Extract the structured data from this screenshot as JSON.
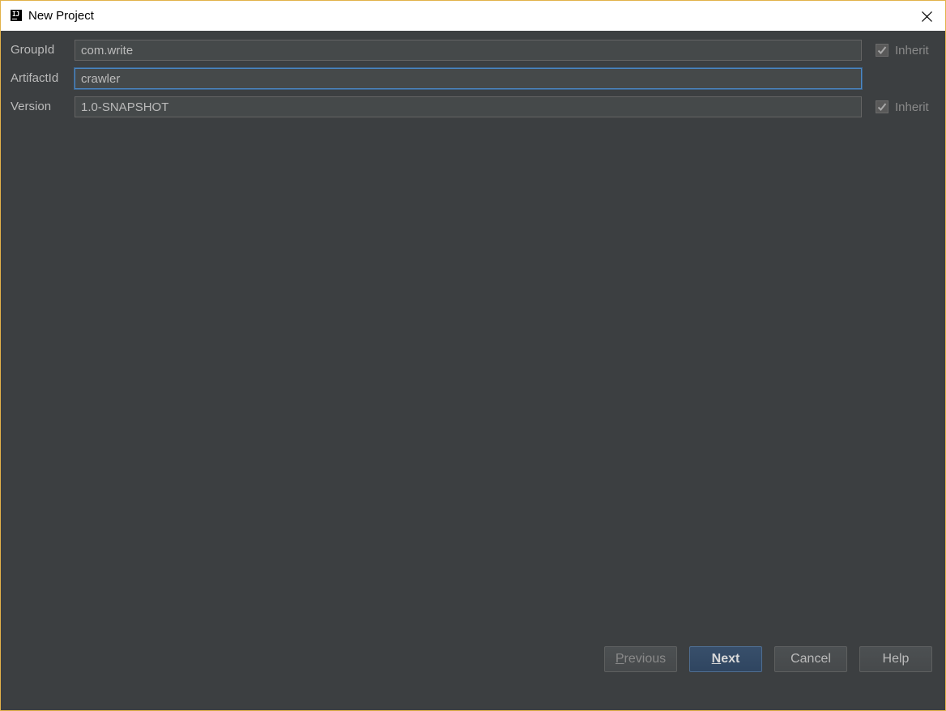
{
  "window": {
    "title": "New Project",
    "app_icon_text": "IJ"
  },
  "form": {
    "group_id": {
      "label": "GroupId",
      "value": "com.write",
      "inherit_label": "Inherit",
      "inherit_checked": true
    },
    "artifact_id": {
      "label": "ArtifactId",
      "value": "crawler"
    },
    "version": {
      "label": "Version",
      "value": "1.0-SNAPSHOT",
      "inherit_label": "Inherit",
      "inherit_checked": true
    }
  },
  "buttons": {
    "previous": {
      "mnemonic": "P",
      "rest": "revious"
    },
    "next": {
      "mnemonic": "N",
      "rest": "ext"
    },
    "cancel": "Cancel",
    "help": "Help"
  },
  "colors": {
    "background": "#3c3f41",
    "focus_border": "#4a88c7",
    "default_button": "#365880",
    "window_border": "#e2b24a"
  },
  "icons": {
    "app": "intellij-idea-icon",
    "close": "close-icon",
    "check": "check-icon"
  }
}
